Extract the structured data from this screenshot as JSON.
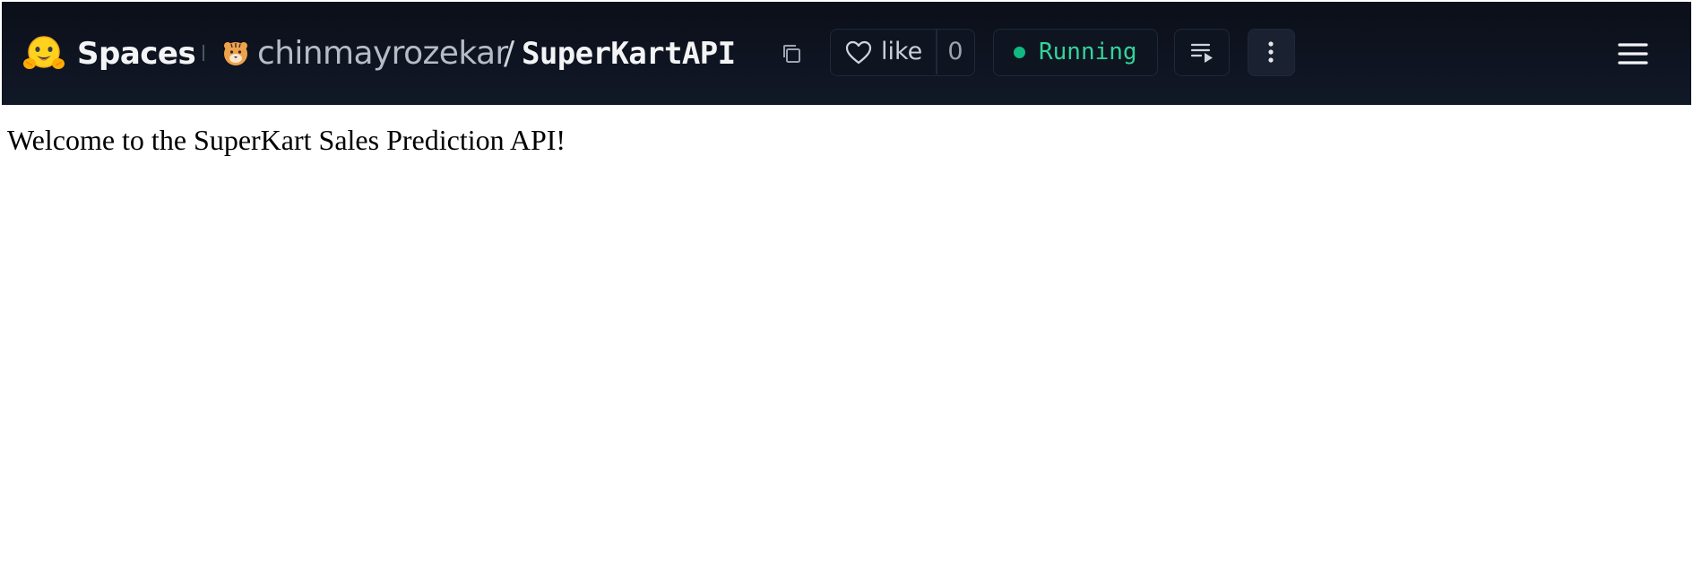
{
  "header": {
    "brand": "Spaces",
    "owner": "chinmayrozekar",
    "separator": "/",
    "repo": "SuperKartAPI",
    "like_label": "like",
    "like_count": "0",
    "status": "Running",
    "icons": {
      "logo": "hugging-face-icon",
      "owner_avatar": "tiger-avatar-icon",
      "copy": "copy-icon",
      "like": "heart-icon",
      "status": "status-dot-icon",
      "logs": "logs-icon",
      "more": "more-vertical-icon",
      "menu": "hamburger-menu-icon"
    },
    "colors": {
      "bar_background": "#0b0f19",
      "status_green": "#34d399",
      "logo_yellow": "#ffd21e"
    }
  },
  "body": {
    "message": "Welcome to the SuperKart Sales Prediction API!"
  }
}
